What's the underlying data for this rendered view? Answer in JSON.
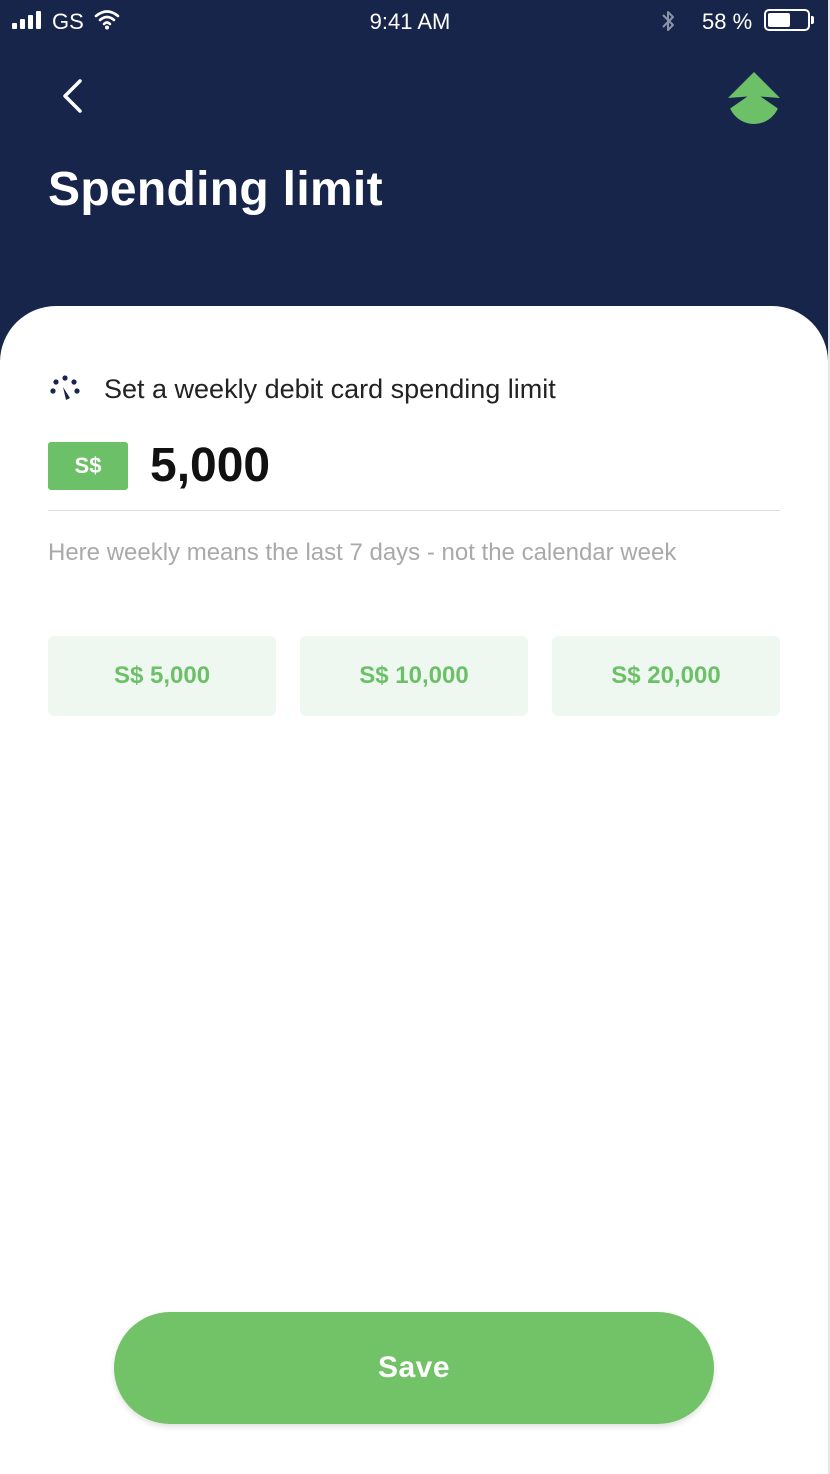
{
  "status_bar": {
    "carrier": "GS",
    "time": "9:41 AM",
    "battery_percent": "58 %",
    "battery_level": 0.58
  },
  "header": {
    "title": "Spending limit",
    "background_color": "#18254a"
  },
  "limit": {
    "description": "Set a weekly debit card spending limit",
    "currency": "S$",
    "amount": "5,000",
    "hint": "Here weekly means the last 7 days - not the calendar week"
  },
  "presets": [
    {
      "label": "S$ 5,000"
    },
    {
      "label": "S$ 10,000"
    },
    {
      "label": "S$ 20,000"
    }
  ],
  "actions": {
    "save_label": "Save"
  },
  "colors": {
    "accent_green": "#6cc068",
    "preset_bg": "#eff8f0"
  }
}
